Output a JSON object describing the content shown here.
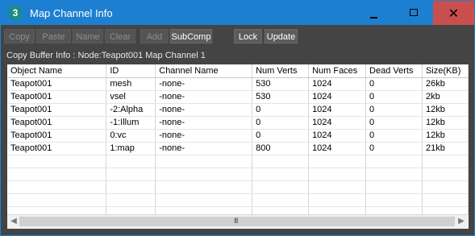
{
  "window": {
    "title": "Map Channel Info",
    "app_icon_glyph": "3",
    "controls": {
      "close_glyph": "✕"
    }
  },
  "toolbar": {
    "buttons": [
      {
        "label": "Copy",
        "enabled": false
      },
      {
        "label": "Paste",
        "enabled": false
      },
      {
        "label": "Name",
        "enabled": false
      },
      {
        "label": "Clear",
        "enabled": false
      },
      {
        "label": "Add",
        "enabled": false
      },
      {
        "label": "SubComp",
        "enabled": true
      },
      {
        "label": "Lock",
        "enabled": true
      },
      {
        "label": "Update",
        "enabled": true
      }
    ]
  },
  "copy_buffer_info": "Copy Buffer Info : Node:Teapot001 Map Channel 1",
  "table": {
    "columns": [
      "Object Name",
      "ID",
      "Channel Name",
      "Num Verts",
      "Num Faces",
      "Dead Verts",
      "Size(KB)"
    ],
    "rows": [
      [
        "Teapot001",
        "mesh",
        "-none-",
        "530",
        "1024",
        "0",
        "26kb"
      ],
      [
        "Teapot001",
        "vsel",
        "-none-",
        "530",
        "1024",
        "0",
        "2kb"
      ],
      [
        "Teapot001",
        "-2:Alpha",
        "-none-",
        "0",
        "1024",
        "0",
        "12kb"
      ],
      [
        "Teapot001",
        "-1:Illum",
        "-none-",
        "0",
        "1024",
        "0",
        "12kb"
      ],
      [
        "Teapot001",
        "0:vc",
        "-none-",
        "0",
        "1024",
        "0",
        "12kb"
      ],
      [
        "Teapot001",
        "1:map",
        "-none-",
        "800",
        "1024",
        "0",
        "21kb"
      ]
    ]
  },
  "scrollbar": {
    "left_arrow": "◀",
    "right_arrow": "▶",
    "grip": "III"
  },
  "colors": {
    "titlebar": "#1e7fd0",
    "close_button": "#c94f4f",
    "panel": "#444444"
  }
}
